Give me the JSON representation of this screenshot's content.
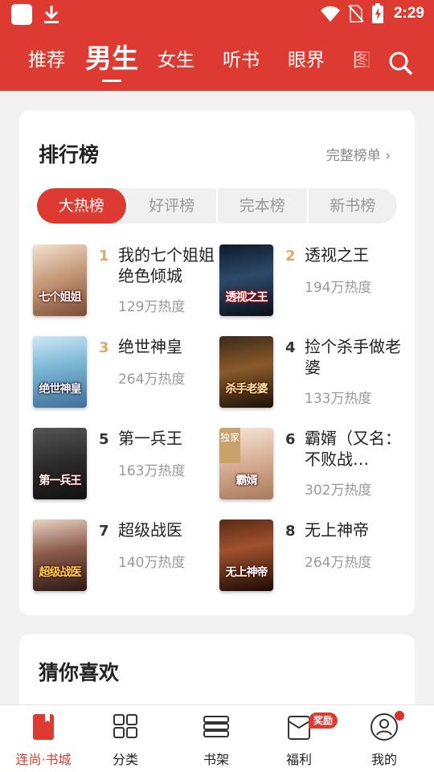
{
  "status": {
    "time": "2:29"
  },
  "nav": {
    "tabs": [
      "推荐",
      "男生",
      "女生",
      "听书",
      "眼界",
      "图书"
    ],
    "active_tab": "男生"
  },
  "ranking": {
    "title": "排行榜",
    "more": "完整榜单 ›",
    "segments": [
      "大热榜",
      "好评榜",
      "完本榜",
      "新书榜"
    ],
    "active_segment": "大热榜",
    "books": [
      {
        "rank": "1",
        "title": "我的七个姐姐绝色倾城",
        "heat": "129万热度",
        "cover_text": "七个姐姐"
      },
      {
        "rank": "2",
        "title": "透视之王",
        "heat": "194万热度",
        "cover_text": "透视之王"
      },
      {
        "rank": "3",
        "title": "绝世神皇",
        "heat": "264万热度",
        "cover_text": "绝世神皇"
      },
      {
        "rank": "4",
        "title": "捡个杀手做老婆",
        "heat": "133万热度",
        "cover_text": "杀手老婆"
      },
      {
        "rank": "5",
        "title": "第一兵王",
        "heat": "163万热度",
        "cover_text": "第一兵王"
      },
      {
        "rank": "6",
        "title": "霸婿（又名：不败战…",
        "heat": "302万热度",
        "cover_text": "霸婿",
        "badge": "独家"
      },
      {
        "rank": "7",
        "title": "超级战医",
        "heat": "140万热度",
        "cover_text": "超级战医"
      },
      {
        "rank": "8",
        "title": "无上神帝",
        "heat": "264万热度",
        "cover_text": "无上神帝"
      }
    ]
  },
  "guess": {
    "title": "猜你喜欢"
  },
  "bottom_nav": {
    "items": [
      "连尚·书城",
      "分类",
      "书架",
      "福利",
      "我的"
    ],
    "welfare_badge": "奖励"
  },
  "colors": {
    "brand": "#dd3b32",
    "rank_top": "#e0a86b"
  }
}
